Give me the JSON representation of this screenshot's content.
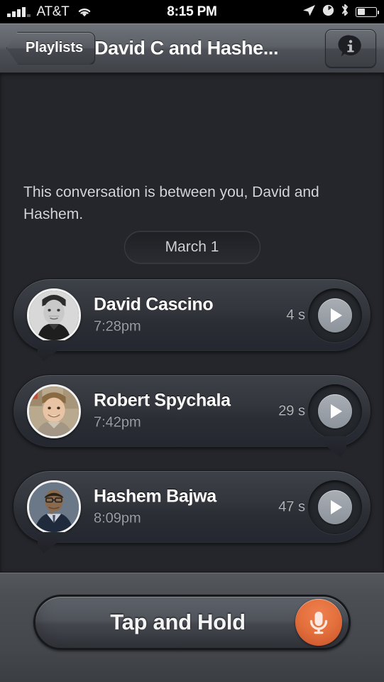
{
  "status_bar": {
    "carrier": "AT&T",
    "time": "8:15 PM",
    "signal_icon": "signal-bars-icon",
    "wifi_icon": "wifi-icon",
    "location_icon": "location-arrow-icon",
    "alarm_icon": "alarm-clock-icon",
    "bluetooth_icon": "bluetooth-icon",
    "battery_icon": "battery-icon",
    "battery_level_percent": 40
  },
  "nav_bar": {
    "back_label": "Playlists",
    "back_icon": "chevron-left-icon",
    "title": "David C and Hashe...",
    "info_button_icon": "info-bubble-icon"
  },
  "conversation": {
    "intro_text": "This conversation is between you, David and Hashem.",
    "date_label": "March 1",
    "messages": [
      {
        "name": "David Cascino",
        "time": "7:28pm",
        "duration": "4 s",
        "avatar_icon": "avatar-david-icon",
        "play_icon": "play-icon",
        "tail": "left"
      },
      {
        "name": "Robert Spychala",
        "time": "7:42pm",
        "duration": "29 s",
        "avatar_icon": "avatar-robert-icon",
        "play_icon": "play-icon",
        "tail": "right"
      },
      {
        "name": "Hashem Bajwa",
        "time": "8:09pm",
        "duration": "47 s",
        "avatar_icon": "avatar-hashem-icon",
        "play_icon": "play-icon",
        "tail": "left"
      }
    ]
  },
  "toolbar": {
    "record_label": "Tap and Hold",
    "mic_icon": "microphone-icon"
  },
  "colors": {
    "background": "#24262b",
    "toolbar": "#4a4c50",
    "bubble": "#34383f",
    "accent_orange": "#e3703c",
    "text_primary": "#ffffff",
    "text_secondary": "#9a9da3"
  }
}
